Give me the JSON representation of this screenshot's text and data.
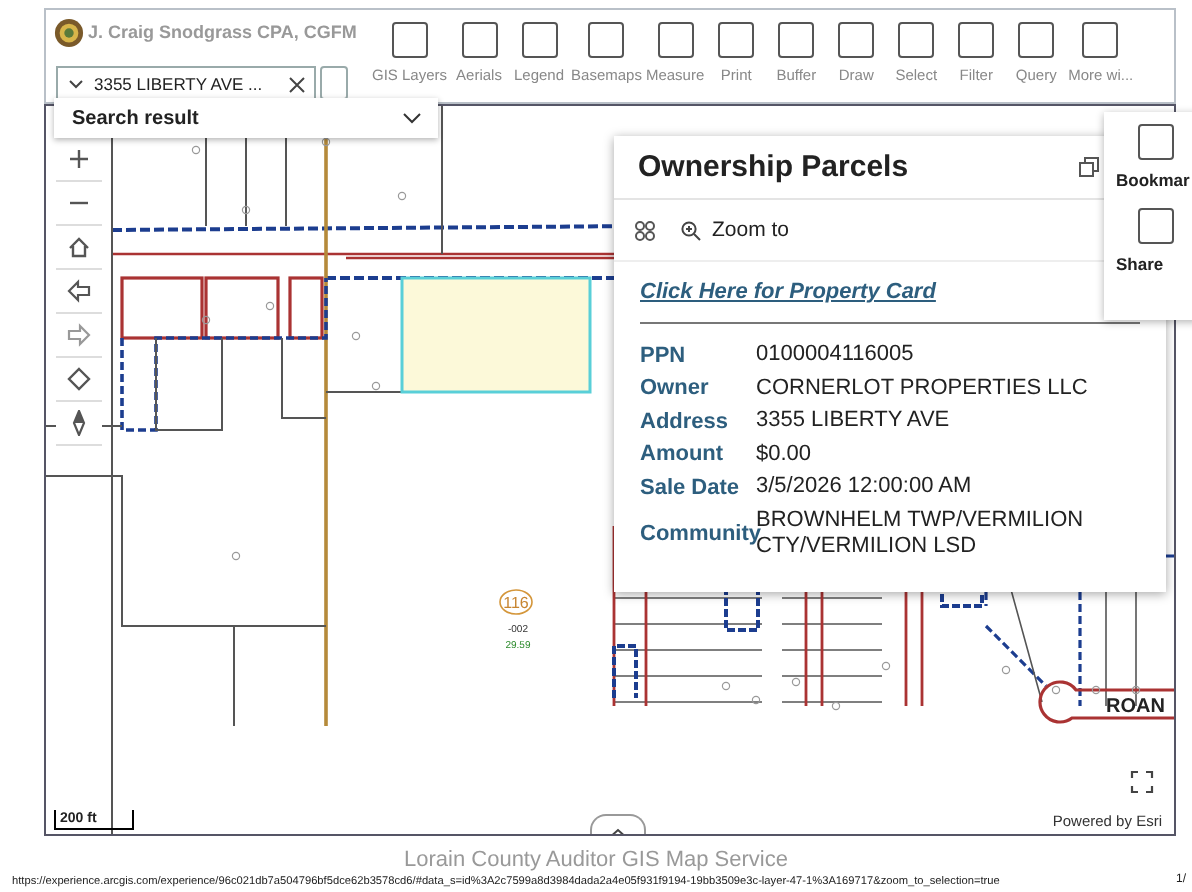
{
  "header": {
    "title": "J. Craig Snodgrass CPA, CGFM"
  },
  "search": {
    "value": "3355 LIBERTY AVE ...",
    "result_label": "Search result"
  },
  "toolbar": {
    "items": [
      {
        "label": "GIS Layers"
      },
      {
        "label": "Aerials"
      },
      {
        "label": "Legend"
      },
      {
        "label": "Basemaps"
      },
      {
        "label": "Measure"
      },
      {
        "label": "Print"
      },
      {
        "label": "Buffer"
      },
      {
        "label": "Draw"
      },
      {
        "label": "Select"
      },
      {
        "label": "Filter"
      },
      {
        "label": "Query"
      },
      {
        "label": "More wi..."
      }
    ]
  },
  "map": {
    "route_shield": "116",
    "parcel_number": "-002",
    "acreage": "29.59",
    "road_label": "ROAN",
    "scale": "200 ft",
    "attribution_prefix": "Powered by",
    "attribution_link": "Esri"
  },
  "popup": {
    "title": "Ownership Parcels",
    "action": "Zoom to",
    "link": "Click Here for Property Card",
    "fields": [
      {
        "label": "PPN",
        "value": "0100004116005"
      },
      {
        "label": "Owner",
        "value": "CORNERLOT PROPERTIES LLC"
      },
      {
        "label": "Address",
        "value": "3355 LIBERTY AVE"
      },
      {
        "label": "Amount",
        "value": "$0.00"
      },
      {
        "label": "Sale Date",
        "value": "3/5/2026 12:00:00 AM"
      },
      {
        "label": "Community",
        "value": "BROWNHELM TWP/VERMILION CTY/VERMILION LSD"
      }
    ]
  },
  "side_panel": {
    "items": [
      {
        "label": "Bookmar"
      },
      {
        "label": "Share"
      }
    ]
  },
  "footer": {
    "text": "Lorain County Auditor GIS Map Service",
    "url": "https://experience.arcgis.com/experience/96c021db7a504796bf5dce62b3578cd6/#data_s=id%3A2c7599a8d3984dada2a4e05f931f9194-19bb3509e3c-layer-47-1%3A169717&zoom_to_selection=true",
    "page": "1/"
  }
}
